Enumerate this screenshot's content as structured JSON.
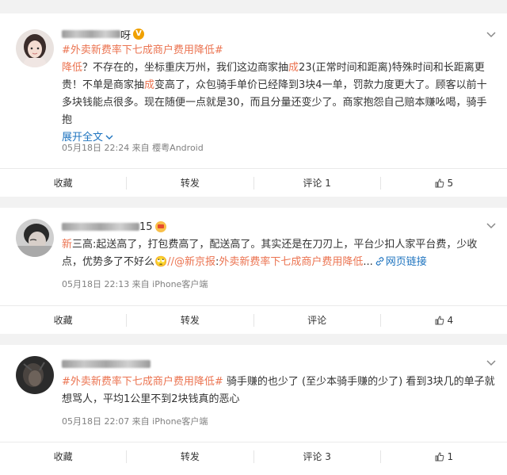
{
  "posts": [
    {
      "hashtag": "#外卖新费率下七成商户费用降低#",
      "body_lead": "降低",
      "body_1": "？不存在的，坐标重庆万州，我们这边商家抽",
      "body_hl1": "成",
      "body_2": "23(正常时间和距离)特殊时间和长距离更贵！不单是商家抽",
      "body_hl2": "成",
      "body_3": "变高了，众包骑手单价已经降到3块4一单，罚款力度更大了。顾客以前十多块钱能点很多。现在随便一点就是30，而且分量还变少了。商家抱怨自己赔本赚吆喝，骑手抱",
      "expand": "展开全文",
      "expand_icon": "chevron-down-icon",
      "meta": "05月18日 22:24  来自 樱粤Android",
      "name_suffix": "呀",
      "badge": "V",
      "actions": [
        "收藏",
        "转发",
        "评论 1",
        "5"
      ]
    },
    {
      "body_lead": "新",
      "body_1": "三高:起送高了，打包费高了，配送高了。其实还是在刀刃上，平台少扣人家平台费，少收点，优势多了不好么",
      "body_emoji": "🙄",
      "body_mention": "//@新京报",
      "body_colon": ":",
      "body_link": "外卖新费率下七成商户费用降低",
      "body_ellipsis": "...",
      "web_link": "网页链接",
      "meta": "05月18日 22:13  来自 iPhone客户端",
      "name_suffix": "15",
      "actions": [
        "收藏",
        "转发",
        "评论",
        "4"
      ]
    },
    {
      "hashtag": "#外卖新费率下七成商户费用降低#",
      "body_1": " 骑手赚的也少了 (至少本骑手赚的少了) 看到3块几的单子就想骂人，平均1公里不到2块钱真的恶心",
      "meta": "05月18日 22:07  来自 iPhone客户端",
      "actions": [
        "收藏",
        "转发",
        "评论 3",
        "1"
      ]
    }
  ],
  "colors": {
    "accent": "#eb7350",
    "link": "#1d73bf",
    "meta": "#808080",
    "bg": "#f2f2f2"
  }
}
